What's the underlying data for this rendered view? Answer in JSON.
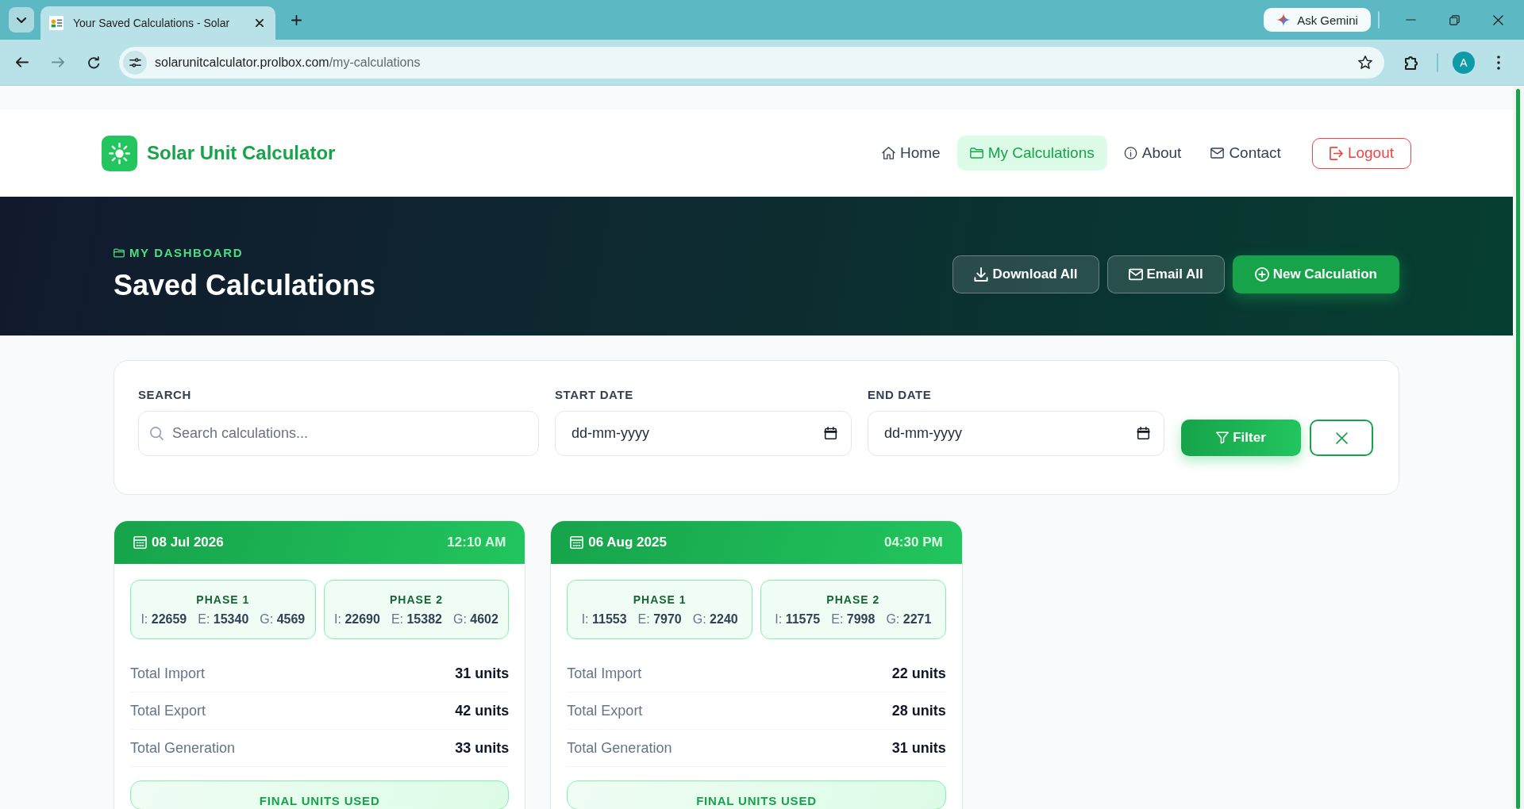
{
  "browser": {
    "tabs": [
      {
        "title": "Your Saved Calculations - Solar",
        "selected": true
      }
    ],
    "forward_disabled": true,
    "url": {
      "host": "solarunitcalculator.prolbox.com",
      "path": "/my-calculations"
    },
    "gemini_button": "Ask Gemini",
    "profile_initial": "A"
  },
  "header": {
    "brand": "Solar Unit Calculator",
    "nav": [
      {
        "label": "Home",
        "selected": false
      },
      {
        "label": "My Calculations",
        "selected": true
      },
      {
        "label": "About",
        "selected": false
      },
      {
        "label": "Contact",
        "selected": false
      }
    ],
    "logout": "Logout"
  },
  "hero": {
    "eyebrow": "MY DASHBOARD",
    "title": "Saved Calculations",
    "actions": [
      {
        "label": "Download All",
        "kind": "outline"
      },
      {
        "label": "Email All",
        "kind": "outline"
      },
      {
        "label": "New Calculation",
        "kind": "primary"
      }
    ]
  },
  "filters": {
    "fields": [
      {
        "label": "SEARCH",
        "kind": "search",
        "placeholder": "Search calculations..."
      },
      {
        "label": "START DATE",
        "kind": "date",
        "placeholder": "dd-mm-yyyy"
      },
      {
        "label": "END DATE",
        "kind": "date",
        "placeholder": "dd-mm-yyyy"
      }
    ],
    "filter_button": "Filter"
  },
  "calculations": [
    {
      "date": "08 Jul 2026",
      "time": "12:10 AM",
      "phases": [
        {
          "title": "PHASE 1",
          "readings": [
            "I: **22659**",
            "E: **15340**",
            "G: **4569**"
          ]
        },
        {
          "title": "PHASE 2",
          "readings": [
            "I: **22690**",
            "E: **15382**",
            "G: **4602**"
          ]
        }
      ],
      "totals": [
        {
          "label": "Total Import",
          "value": "31 units"
        },
        {
          "label": "Total Export",
          "value": "42 units"
        },
        {
          "label": "Total Generation",
          "value": "33 units"
        }
      ],
      "final_label": "FINAL UNITS USED"
    },
    {
      "date": "06 Aug 2025",
      "time": "04:30 PM",
      "phases": [
        {
          "title": "PHASE 1",
          "readings": [
            "I: **11553**",
            "E: **7970**",
            "G: **2240**"
          ]
        },
        {
          "title": "PHASE 2",
          "readings": [
            "I: **11575**",
            "E: **7998**",
            "G: **2271**"
          ]
        }
      ],
      "totals": [
        {
          "label": "Total Import",
          "value": "22 units"
        },
        {
          "label": "Total Export",
          "value": "28 units"
        },
        {
          "label": "Total Generation",
          "value": "31 units"
        }
      ],
      "final_label": "FINAL UNITS USED"
    }
  ]
}
